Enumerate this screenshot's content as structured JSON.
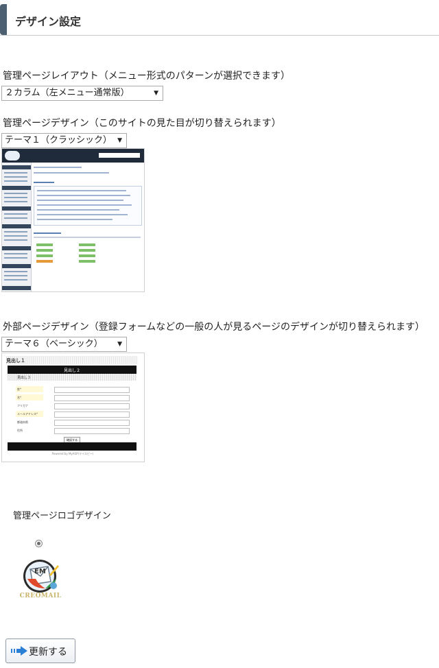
{
  "page": {
    "title": "デザイン設定"
  },
  "admin_layout": {
    "label": "管理ページレイアウト（メニュー形式のパターンが選択できます）",
    "selected": "２カラム（左メニュー通常版）"
  },
  "admin_design": {
    "label": "管理ページデザイン（このサイトの見た目が切り替えられます）",
    "selected": "テーマ１（クラッシック）"
  },
  "external_design": {
    "label": "外部ページデザイン（登録フォームなどの一般の人が見るページのデザインが切り替えられます）",
    "selected": "テーマ６（ベーシック）",
    "preview": {
      "heading1": "見出し１",
      "heading2": "見出し２",
      "heading3": "見出し３",
      "fields": [
        "姓*",
        "名*",
        "フリガナ",
        "メールアドレス*",
        "都道府県",
        "住所"
      ],
      "submit": "確認する",
      "footer": "Powered by MyASP(マイスピー)"
    }
  },
  "logo_design": {
    "label": "管理ページロゴデザイン",
    "logo_text": "CREOMAIL",
    "selected": true
  },
  "actions": {
    "update": "更新する"
  },
  "colors": {
    "heading_bar": "#4d6072",
    "admin_nav": "#1f2b3a",
    "button_arrow": "#2b7fd4"
  },
  "icons": {
    "update": "right-arrow-icon",
    "select": "triangle-down-icon"
  }
}
